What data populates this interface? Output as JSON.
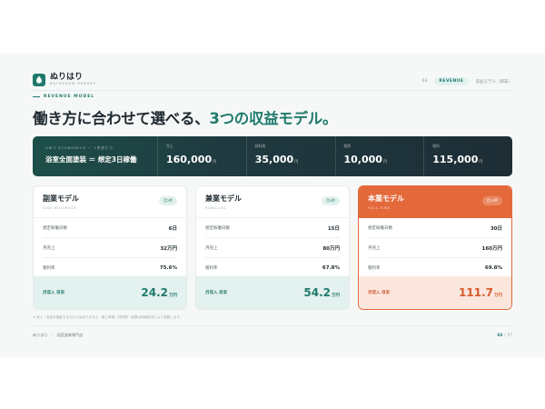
{
  "brand": {
    "name": "ぬりはり",
    "subtitle": "BATHROOM REMAKE"
  },
  "nav": {
    "number": "03",
    "active": "REVENUE",
    "label": "収益モデル（目安）"
  },
  "eyebrow": "REVENUE MODEL",
  "headline": {
    "lead": "働き方に合わせて選べる、",
    "accent": "3つの収益モデル。"
  },
  "unit_economics": {
    "label": "UNIT ECONOMICS ／ 1件あたり",
    "value": "浴室全面塗装 ＝ 想定3日稼働",
    "metrics": [
      {
        "label": "売上",
        "value": "160,000",
        "unit": "円"
      },
      {
        "label": "材料費",
        "value": "35,000",
        "unit": "円"
      },
      {
        "label": "経費",
        "value": "10,000",
        "unit": "円"
      },
      {
        "label": "粗利",
        "value": "115,000",
        "unit": "円"
      }
    ]
  },
  "cards": [
    {
      "title": "副業モデル",
      "subtitle": "SIDE BUSINESS",
      "badge": "月2件",
      "rows": [
        {
          "label": "想定稼働日数",
          "value": "6日"
        },
        {
          "label": "月売上",
          "value": "32万円"
        },
        {
          "label": "粗利率",
          "value": "75.6%"
        }
      ],
      "foot_label": "月収入 目安",
      "foot_value": "24.2",
      "foot_unit": "万円"
    },
    {
      "title": "兼業モデル",
      "subtitle": "PARALLEL",
      "badge": "月5件",
      "rows": [
        {
          "label": "想定稼働日数",
          "value": "15日"
        },
        {
          "label": "月売上",
          "value": "80万円"
        },
        {
          "label": "粗利率",
          "value": "67.8%"
        }
      ],
      "foot_label": "月収入 目安",
      "foot_value": "54.2",
      "foot_unit": "万円"
    },
    {
      "title": "本業モデル",
      "subtitle": "FULL-TIME",
      "badge": "月10件",
      "rows": [
        {
          "label": "想定稼働日数",
          "value": "30日"
        },
        {
          "label": "月売上",
          "value": "160万円"
        },
        {
          "label": "粗利率",
          "value": "69.8%"
        }
      ],
      "foot_label": "月収入 目安",
      "foot_value": "111.7",
      "foot_unit": "万円"
    }
  ],
  "note": "※ 売上・収益を保証するものではありません。施工単価・材料費・経費は地域状況により変動します。",
  "footer": {
    "brand": "ぬりはり",
    "section": "浴室塗装専門店",
    "page_current": "04",
    "page_total": "07"
  },
  "colors": {
    "accent": "#1f7a6c",
    "highlight": "#e4693a",
    "dark": "#1e2d35"
  }
}
